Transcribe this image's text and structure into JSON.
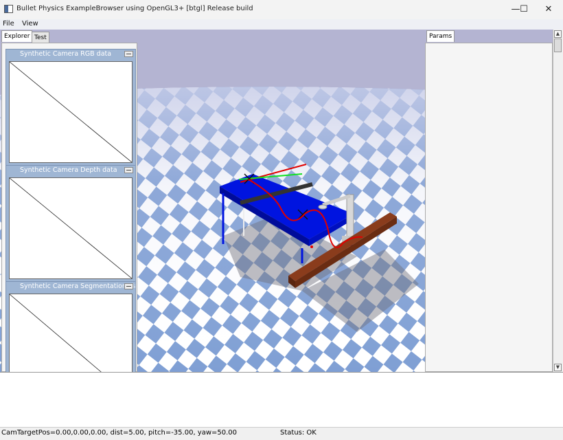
{
  "window": {
    "title": "Bullet Physics ExampleBrowser using OpenGL3+ [btgl] Release build",
    "minimize_glyph": "—",
    "maximize_glyph": "☐",
    "close_glyph": "✕"
  },
  "menu": {
    "items": [
      {
        "label": "File"
      },
      {
        "label": "View"
      }
    ]
  },
  "left_tabs": [
    {
      "label": "Explorer"
    },
    {
      "label": "Test"
    }
  ],
  "right_tabs": [
    {
      "label": "Params"
    }
  ],
  "camera_windows": [
    {
      "title": "Synthetic Camera RGB data"
    },
    {
      "title": "Synthetic Camera Depth data"
    },
    {
      "title": "Synthetic Camera Segmentation Mask"
    }
  ],
  "status": {
    "camera_info": "CamTargetPos=0.00,0.00,0.00, dist=5.00, pitch=-35.00, yaw=50.00",
    "status_text": "Status: OK"
  },
  "icons": {
    "app": "app-icon",
    "scroll_up": "scroll-up-icon",
    "scroll_down": "scroll-down-icon"
  },
  "colors": {
    "sky": "#b4b4d2",
    "checker_blue": "#7f9fd4",
    "checker_white": "#ffffff",
    "table": "#0014e0",
    "ramp": "#7a3318",
    "trajectory": "#e00000",
    "axis_green": "#10e020",
    "camera_window_frame": "#9fb6d4"
  }
}
